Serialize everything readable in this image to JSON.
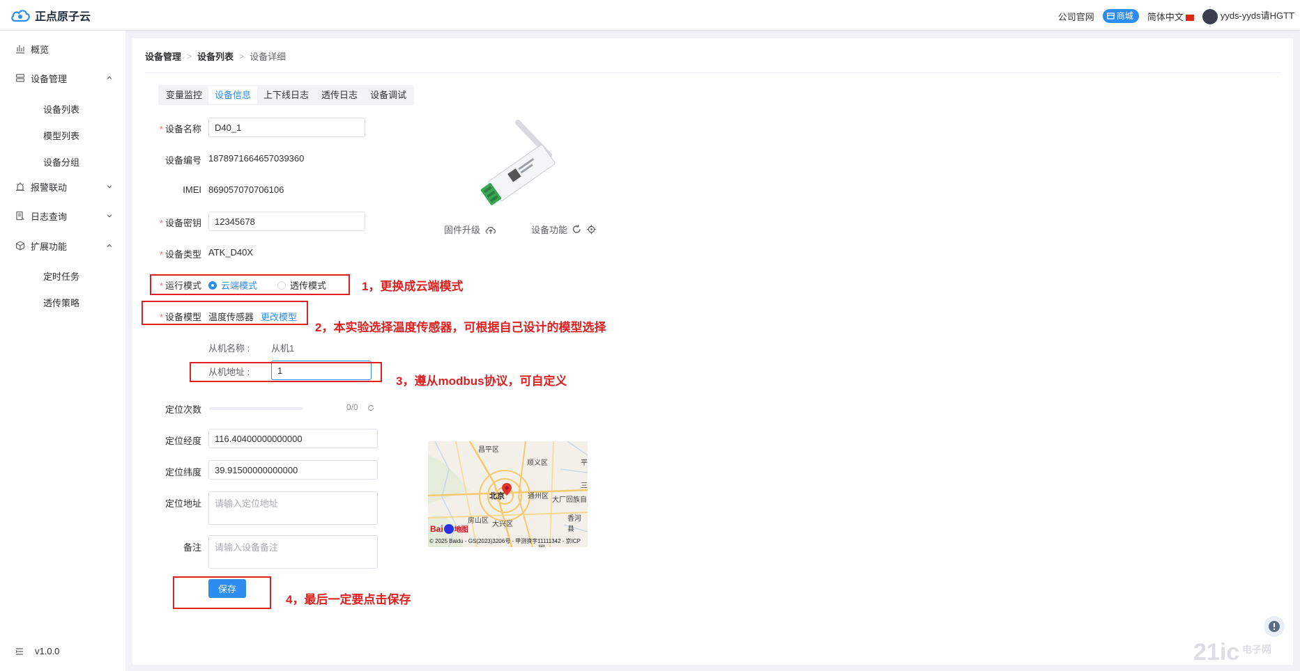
{
  "app": {
    "logo_text": "正点原子云",
    "header": {
      "official_site": "公司官网",
      "mall": "商城",
      "language": "简体中文",
      "username": "yyds-yyds请HGTT"
    }
  },
  "sidebar": {
    "items": [
      {
        "label": "概览",
        "icon": "bar-chart-icon"
      },
      {
        "label": "设备管理",
        "icon": "device-icon",
        "expanded": true
      },
      {
        "label": "设备列表"
      },
      {
        "label": "模型列表"
      },
      {
        "label": "设备分组"
      },
      {
        "label": "报警联动",
        "icon": "alarm-icon",
        "expanded": false
      },
      {
        "label": "日志查询",
        "icon": "log-icon",
        "expanded": false
      },
      {
        "label": "扩展功能",
        "icon": "extension-icon",
        "expanded": true
      },
      {
        "label": "定时任务"
      },
      {
        "label": "透传策略"
      }
    ],
    "version": "v1.0.0"
  },
  "breadcrumb": [
    "设备管理",
    "设备列表",
    "设备详细"
  ],
  "tabs": [
    {
      "label": "变量监控",
      "active": false
    },
    {
      "label": "设备信息",
      "active": true
    },
    {
      "label": "上下线日志",
      "active": false
    },
    {
      "label": "透传日志",
      "active": false
    },
    {
      "label": "设备调试",
      "active": false
    }
  ],
  "form": {
    "device_name": {
      "label": "设备名称",
      "value": "D40_1"
    },
    "device_number": {
      "label": "设备编号",
      "value": "1878971664657039360"
    },
    "imei": {
      "label": "IMEI",
      "value": "869057070706106"
    },
    "device_key": {
      "label": "设备密钥",
      "value": "12345678"
    },
    "device_type": {
      "label": "设备类型",
      "value": "ATK_D40X"
    },
    "run_mode": {
      "label": "运行模式",
      "options": [
        "云端模式",
        "透传模式"
      ],
      "selected": "云端模式"
    },
    "device_model": {
      "label": "设备模型",
      "value": "温度传感器",
      "change_link": "更改模型"
    },
    "slave_name": {
      "label": "从机名称 :",
      "value": "从机1"
    },
    "slave_address": {
      "label": "从机地址 :",
      "value": "1"
    },
    "locate_count": {
      "label": "定位次数",
      "value": "0/0",
      "progress": 0.0
    },
    "longitude": {
      "label": "定位经度",
      "value": "116.40400000000000"
    },
    "latitude": {
      "label": "定位纬度",
      "value": "39.91500000000000"
    },
    "address": {
      "label": "定位地址",
      "placeholder": "请输入定位地址"
    },
    "remark": {
      "label": "备注",
      "placeholder": "请输入设备备注"
    },
    "save_button": "保存"
  },
  "device_panel": {
    "firmware_upgrade": "固件升级",
    "device_function": "设备功能"
  },
  "map": {
    "labels": {
      "changping": "昌平区",
      "shunyi": "顺义区",
      "ping": "平",
      "beijing": "北京",
      "tongzhou": "通州区",
      "dachang": "大厂回族自",
      "san": "三",
      "fangshan": "房山区",
      "daxing": "大兴区",
      "xianghe": "香河县",
      "gu": "固"
    },
    "brand": "Bai",
    "brand_suffix": "地图",
    "copyright": "© 2025 Baidu - GS(2023)3206号 - 甲测资字11111342 - 京ICP"
  },
  "annotations": {
    "note1": "1，更换成云端模式",
    "note2": "2，本实验选择温度传感器，可根据自己设计的模型选择",
    "note3": "3，遵从modbus协议，可自定义",
    "note4": "4，最后一定要点击保存"
  },
  "colors": {
    "accent": "#2d8cf0",
    "annotation": "#e02020"
  }
}
